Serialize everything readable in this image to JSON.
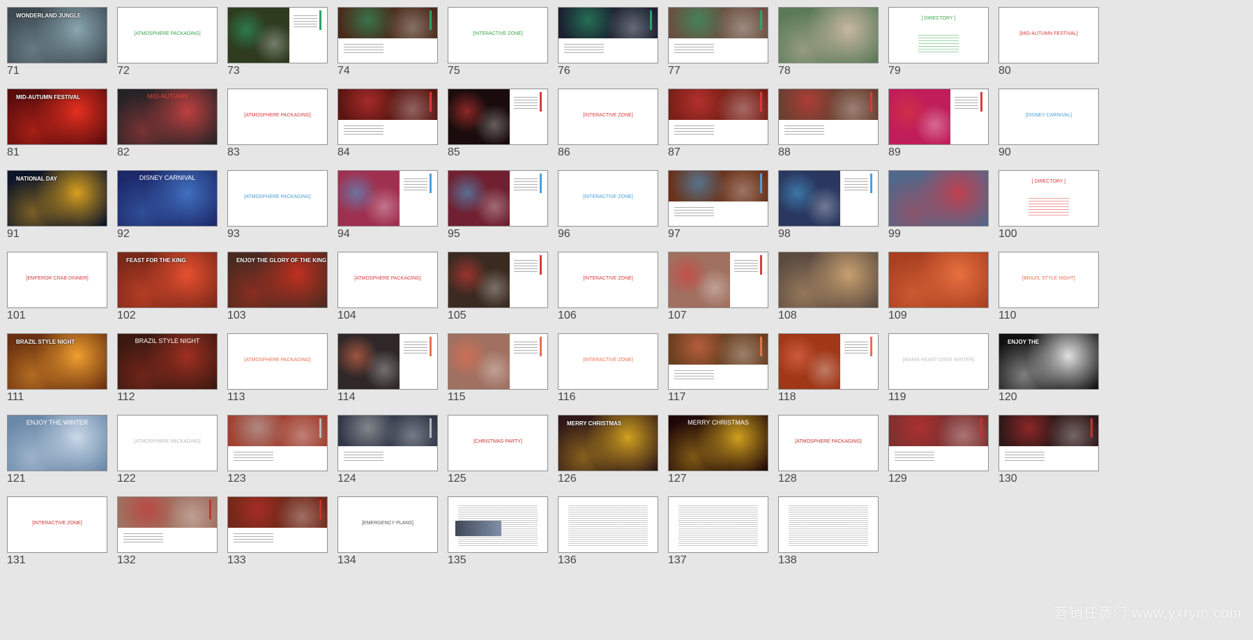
{
  "slides": [
    {
      "num": "71",
      "kind": "photo",
      "bg": "#3d4a52",
      "accent": "#8aa6b0",
      "title": "WONDERLAND JUNGLE",
      "sub": ""
    },
    {
      "num": "72",
      "kind": "section",
      "color": "#3aa64a",
      "title": "[ATMOSPHERE PACKAGING]",
      "sub": ""
    },
    {
      "num": "73",
      "kind": "split",
      "bg": "#2e3b1f",
      "accent": "#2ca36a",
      "color": "#2ca36a",
      "title": "",
      "sub": ""
    },
    {
      "num": "74",
      "kind": "split-bottom",
      "bg": "#4a2a1a",
      "accent": "#2ca36a",
      "color": "#2ca36a",
      "title": "",
      "sub": ""
    },
    {
      "num": "75",
      "kind": "section",
      "color": "#3aa64a",
      "title": "[INTERACTIVE ZONE]",
      "sub": ""
    },
    {
      "num": "76",
      "kind": "split-bottom",
      "bg": "#1a2030",
      "accent": "#2ca36a",
      "color": "#2ca36a",
      "title": "",
      "sub": ""
    },
    {
      "num": "77",
      "kind": "split-bottom",
      "bg": "#6a5040",
      "accent": "#2ca36a",
      "color": "#2ca36a",
      "title": "",
      "sub": ""
    },
    {
      "num": "78",
      "kind": "photo",
      "bg": "#5a7a58",
      "accent": "#c9b7a3",
      "title": "",
      "sub": ""
    },
    {
      "num": "79",
      "kind": "directory",
      "color": "#3aa64a",
      "title": "[ DIRECTORY ]",
      "sub": ""
    },
    {
      "num": "80",
      "kind": "section",
      "color": "#d93a3a",
      "title": "[MID-AUTUMN FESTIVAL]",
      "sub": ""
    },
    {
      "num": "81",
      "kind": "photo",
      "bg": "#5a0c0c",
      "accent": "#e53020",
      "title": "MID-AUTUMN FESTIVAL",
      "sub": ""
    },
    {
      "num": "82",
      "kind": "center-title",
      "bg": "#262326",
      "accent": "#c04040",
      "color": "#e0403a",
      "title": "MID-AUTUMN",
      "sub": ""
    },
    {
      "num": "83",
      "kind": "section",
      "color": "#d93a3a",
      "title": "[ATMOSPHERE PACKAGING]",
      "sub": ""
    },
    {
      "num": "84",
      "kind": "split-bottom",
      "bg": "#5a1510",
      "accent": "#d93a3a",
      "color": "#d93a3a",
      "title": "",
      "sub": ""
    },
    {
      "num": "85",
      "kind": "split",
      "bg": "#1a0c0c",
      "accent": "#d93a3a",
      "color": "#d93a3a",
      "title": "",
      "sub": ""
    },
    {
      "num": "86",
      "kind": "section",
      "color": "#d93a3a",
      "title": "[INTERACTIVE ZONE]",
      "sub": ""
    },
    {
      "num": "87",
      "kind": "split-bottom",
      "bg": "#7a2018",
      "accent": "#d93a3a",
      "color": "#d93a3a",
      "title": "",
      "sub": ""
    },
    {
      "num": "88",
      "kind": "split-bottom",
      "bg": "#6a4030",
      "accent": "#d93a3a",
      "color": "#d93a3a",
      "title": "",
      "sub": ""
    },
    {
      "num": "89",
      "kind": "split",
      "bg": "#c01e5a",
      "accent": "#d93a3a",
      "color": "#d93a3a",
      "title": "",
      "sub": ""
    },
    {
      "num": "90",
      "kind": "section",
      "color": "#4aa0d8",
      "title": "[DISNEY CARNIVAL]",
      "sub": ""
    },
    {
      "num": "91",
      "kind": "photo",
      "bg": "#0c1428",
      "accent": "#d8a020",
      "title": "NATIONAL DAY",
      "sub": ""
    },
    {
      "num": "92",
      "kind": "center-title",
      "bg": "#1c2868",
      "accent": "#4070c0",
      "color": "#ffffff",
      "title": "DISNEY CARNIVAL",
      "sub": ""
    },
    {
      "num": "93",
      "kind": "section",
      "color": "#4aa0d8",
      "title": "[ATMOSPHERE PACKAGING]",
      "sub": ""
    },
    {
      "num": "94",
      "kind": "split",
      "bg": "#a03050",
      "accent": "#4aa0d8",
      "color": "#4aa0d8",
      "title": "",
      "sub": ""
    },
    {
      "num": "95",
      "kind": "split",
      "bg": "#702030",
      "accent": "#4aa0d8",
      "color": "#4aa0d8",
      "title": "",
      "sub": ""
    },
    {
      "num": "96",
      "kind": "section",
      "color": "#4aa0d8",
      "title": "[INTERACTIVE ZONE]",
      "sub": ""
    },
    {
      "num": "97",
      "kind": "split-bottom",
      "bg": "#6a3018",
      "accent": "#4aa0d8",
      "color": "#4aa0d8",
      "title": "",
      "sub": ""
    },
    {
      "num": "98",
      "kind": "split",
      "bg": "#2a3860",
      "accent": "#4aa0d8",
      "color": "#4aa0d8",
      "title": "",
      "sub": ""
    },
    {
      "num": "99",
      "kind": "photo",
      "bg": "#50688a",
      "accent": "#c04050",
      "title": "",
      "sub": ""
    },
    {
      "num": "100",
      "kind": "directory",
      "color": "#d93a3a",
      "title": "[ DIRECTORY ]",
      "sub": ""
    },
    {
      "num": "101",
      "kind": "section",
      "color": "#d93a3a",
      "title": "[EMPEROR CRAB DINNER]",
      "sub": ""
    },
    {
      "num": "102",
      "kind": "photo",
      "bg": "#7a2818",
      "accent": "#e85030",
      "title": "FEAST FOR THE KING",
      "sub": ""
    },
    {
      "num": "103",
      "kind": "photo",
      "bg": "#4a2a20",
      "accent": "#c03020",
      "title": "ENJOY THE GLORY OF THE KING",
      "sub": ""
    },
    {
      "num": "104",
      "kind": "section",
      "color": "#d93a3a",
      "title": "[ATMOSPHERE PACKAGING]",
      "sub": ""
    },
    {
      "num": "105",
      "kind": "split",
      "bg": "#3a2a20",
      "accent": "#d93a3a",
      "color": "#d93a3a",
      "title": "",
      "sub": ""
    },
    {
      "num": "106",
      "kind": "section",
      "color": "#d93a3a",
      "title": "[INTERACTIVE ZONE]",
      "sub": ""
    },
    {
      "num": "107",
      "kind": "split",
      "bg": "#a07060",
      "accent": "#d93a3a",
      "color": "#d93a3a",
      "title": "",
      "sub": ""
    },
    {
      "num": "108",
      "kind": "photo",
      "bg": "#5a4a40",
      "accent": "#c8a070",
      "title": "",
      "sub": ""
    },
    {
      "num": "109",
      "kind": "photo",
      "bg": "#a84020",
      "accent": "#e87040",
      "title": "",
      "sub": ""
    },
    {
      "num": "110",
      "kind": "section",
      "color": "#e87050",
      "title": "[BRAZIL STYLE NIGHT]",
      "sub": ""
    },
    {
      "num": "111",
      "kind": "photo",
      "bg": "#6a3010",
      "accent": "#f0a030",
      "title": "BRAZIL STYLE NIGHT",
      "sub": ""
    },
    {
      "num": "112",
      "kind": "center-title",
      "bg": "#3a1810",
      "accent": "#a03020",
      "color": "#ffffff",
      "title": "BRAZIL STYLE NIGHT",
      "sub": ""
    },
    {
      "num": "113",
      "kind": "section",
      "color": "#e87050",
      "title": "[ATMOSPHERE PACKAGING]",
      "sub": ""
    },
    {
      "num": "114",
      "kind": "split",
      "bg": "#302828",
      "accent": "#e87050",
      "color": "#e87050",
      "title": "",
      "sub": ""
    },
    {
      "num": "115",
      "kind": "split",
      "bg": "#a07060",
      "accent": "#e87050",
      "color": "#e87050",
      "title": "",
      "sub": ""
    },
    {
      "num": "116",
      "kind": "section",
      "color": "#e87050",
      "title": "[INTERACTIVE ZONE]",
      "sub": ""
    },
    {
      "num": "117",
      "kind": "split-bottom",
      "bg": "#6a4020",
      "accent": "#e87050",
      "color": "#e87050",
      "title": "",
      "sub": ""
    },
    {
      "num": "118",
      "kind": "split",
      "bg": "#a03818",
      "accent": "#e87050",
      "color": "#e87050",
      "title": "",
      "sub": ""
    },
    {
      "num": "119",
      "kind": "section",
      "color": "#c0c0c0",
      "title": "[WARM HEART OVER WINTER]",
      "sub": ""
    },
    {
      "num": "120",
      "kind": "photo",
      "bg": "#101010",
      "accent": "#e0e0e0",
      "title": "ENJOY THE",
      "sub": ""
    },
    {
      "num": "121",
      "kind": "center-title",
      "bg": "#6a88a8",
      "accent": "#c8d8e8",
      "color": "#ffffff",
      "title": "ENJOY THE WINTER",
      "sub": ""
    },
    {
      "num": "122",
      "kind": "section",
      "color": "#b8b8b8",
      "title": "[ATMOSPHERE PACKAGING]",
      "sub": ""
    },
    {
      "num": "123",
      "kind": "split-bottom",
      "bg": "#a04030",
      "accent": "#b8b8b8",
      "color": "#b8b8b8",
      "title": "",
      "sub": ""
    },
    {
      "num": "124",
      "kind": "split-bottom",
      "bg": "#303848",
      "accent": "#b8b8b8",
      "color": "#b8b8b8",
      "title": "",
      "sub": ""
    },
    {
      "num": "125",
      "kind": "section",
      "color": "#c83030",
      "title": "[CHRISTMAS PARTY]",
      "sub": ""
    },
    {
      "num": "126",
      "kind": "photo",
      "bg": "#301818",
      "accent": "#d0a020",
      "title": "MERRY CHRISTMAS",
      "sub": ""
    },
    {
      "num": "127",
      "kind": "center-title",
      "bg": "#200808",
      "accent": "#d0a020",
      "color": "#ffffff",
      "title": "MERRY CHRISTMAS",
      "sub": ""
    },
    {
      "num": "128",
      "kind": "section",
      "color": "#c83030",
      "title": "[ATMOSPHERE PACKAGING]",
      "sub": ""
    },
    {
      "num": "129",
      "kind": "split-bottom",
      "bg": "#803030",
      "accent": "#c83030",
      "color": "#c83030",
      "title": "",
      "sub": ""
    },
    {
      "num": "130",
      "kind": "split-bottom",
      "bg": "#301818",
      "accent": "#c83030",
      "color": "#c83030",
      "title": "",
      "sub": ""
    },
    {
      "num": "131",
      "kind": "section",
      "color": "#c83030",
      "title": "[INTERACTIVE ZONE]",
      "sub": ""
    },
    {
      "num": "132",
      "kind": "split-bottom",
      "bg": "#a07060",
      "accent": "#c83030",
      "color": "#c83030",
      "title": "",
      "sub": ""
    },
    {
      "num": "133",
      "kind": "split-bottom",
      "bg": "#702818",
      "accent": "#c83030",
      "color": "#c83030",
      "title": "",
      "sub": ""
    },
    {
      "num": "134",
      "kind": "section",
      "color": "#555555",
      "title": "[EMERGENCY PLANS]",
      "sub": ""
    },
    {
      "num": "135",
      "kind": "doc-img",
      "bg": "#404858",
      "accent": "#888888",
      "color": "#888888",
      "title": "",
      "sub": ""
    },
    {
      "num": "136",
      "kind": "doc",
      "color": "#888888",
      "title": "",
      "sub": ""
    },
    {
      "num": "137",
      "kind": "doc",
      "color": "#888888",
      "title": "",
      "sub": ""
    },
    {
      "num": "138",
      "kind": "doc",
      "color": "#888888",
      "title": "",
      "sub": ""
    }
  ],
  "watermark": "营销任意门 www.yxrym.com"
}
